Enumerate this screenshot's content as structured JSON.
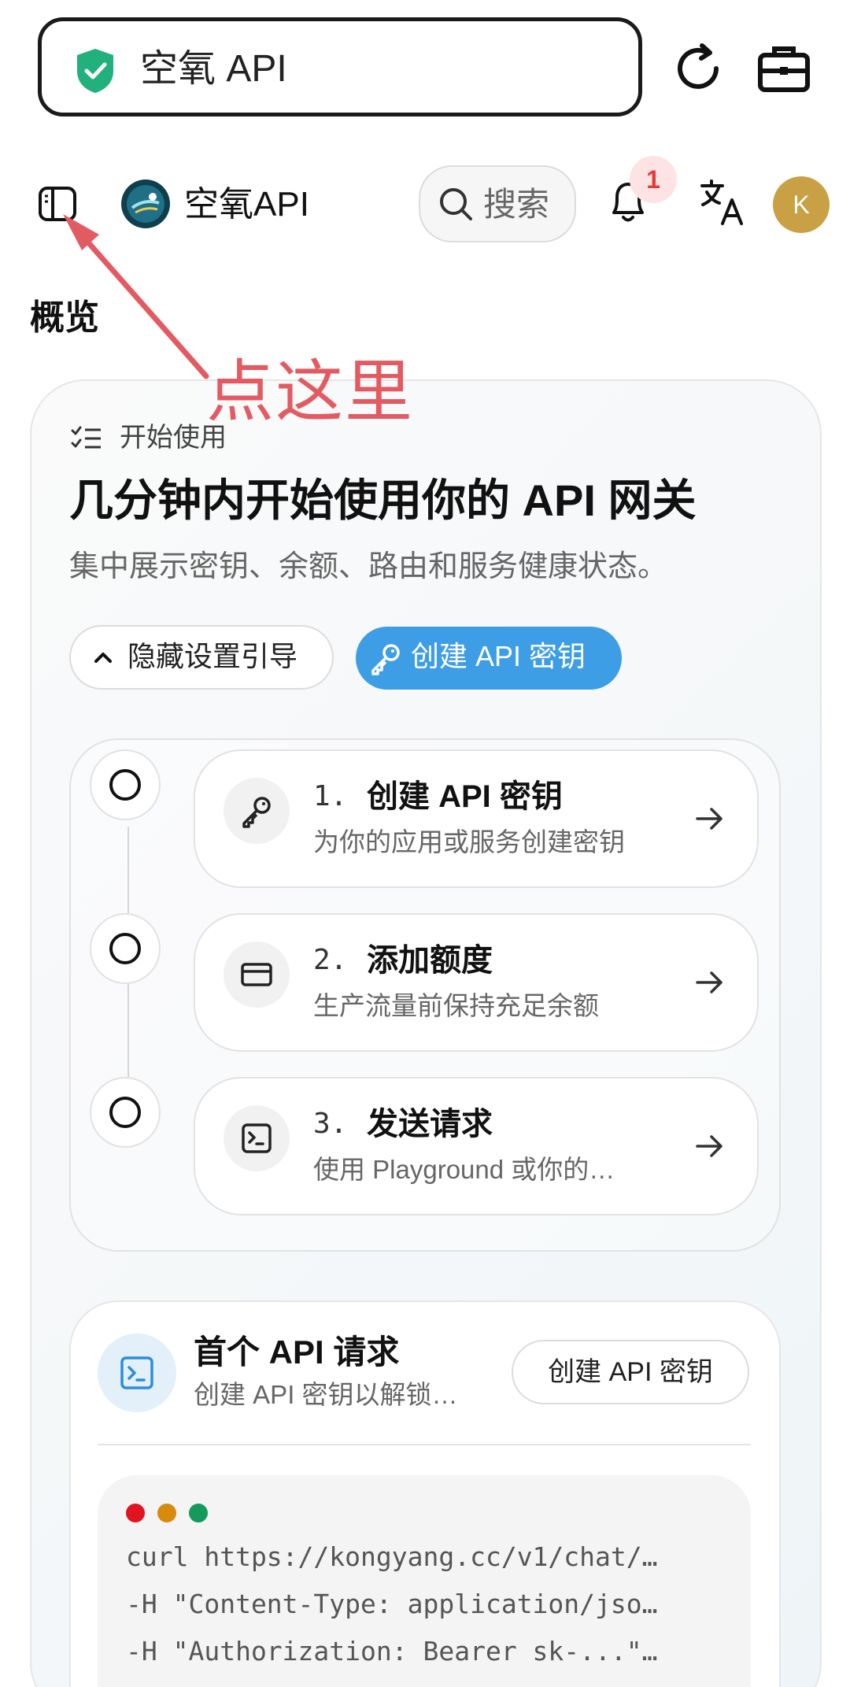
{
  "browser": {
    "url_title": "空氧 API"
  },
  "header": {
    "brand": "空氧API",
    "search_label": "搜索",
    "notification_count": "1",
    "avatar_letter": "K"
  },
  "page": {
    "title": "概览"
  },
  "annotation": {
    "text": "点这里",
    "color": "#e35b62"
  },
  "hero": {
    "kicker": "开始使用",
    "title": "几分钟内开始使用你的 API 网关",
    "subtitle": "集中展示密钥、余额、路由和服务健康状态。",
    "hide_button": "隐藏设置引导",
    "create_button": "创建 API 密钥"
  },
  "steps": [
    {
      "num": "1.",
      "title": "创建 API 密钥",
      "desc": "为你的应用或服务创建密钥",
      "icon": "key-icon"
    },
    {
      "num": "2.",
      "title": "添加额度",
      "desc": "生产流量前保持充足余额",
      "icon": "credit-card-icon"
    },
    {
      "num": "3.",
      "title": "发送请求",
      "desc": "使用 Playground 或你的…",
      "icon": "terminal-icon"
    }
  ],
  "first_request": {
    "title": "首个 API 请求",
    "subtitle": "创建 API 密钥以解锁…",
    "button": "创建 API 密钥",
    "code_lines": [
      "curl https://kongyang.cc/v1/chat/…",
      "-H \"Content-Type: application/jso…",
      "-H \"Authorization: Bearer sk-...\"…"
    ]
  },
  "colors": {
    "accent": "#3d9ee6",
    "shield": "#22b07d",
    "avatar": "#c9a043",
    "dot_red": "#e0151f",
    "dot_yellow": "#d68b0c",
    "dot_green": "#149a5a"
  }
}
